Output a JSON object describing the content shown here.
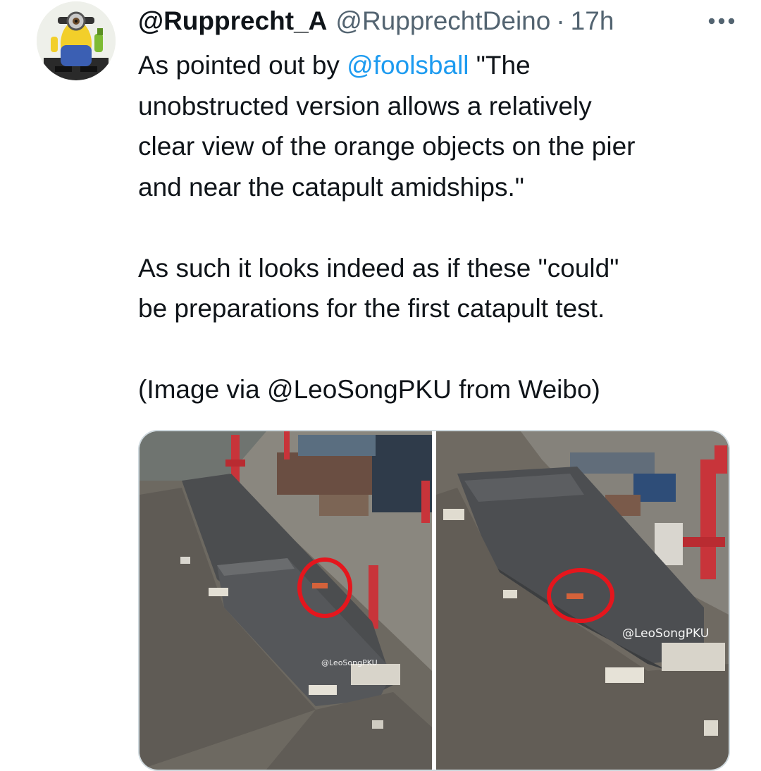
{
  "tweet": {
    "display_name": "@Rupprecht_A",
    "handle": "@RupprechtDeino",
    "separator": "·",
    "timestamp": "17h",
    "body": {
      "p1_prefix": "As pointed out by ",
      "p1_mention": "@foolsball",
      "p1_line1_suffix": " \"The",
      "p1_line2": "unobstructed version allows a relatively",
      "p1_line3": "clear view of the orange objects on the pier",
      "p1_line4": "and near the catapult amidships.\"",
      "p2_line1": "As such it looks indeed as if these \"could\"",
      "p2_line2": "be preparations for the first catapult test.",
      "p3": "(Image via @LeoSongPKU from Weibo)"
    }
  },
  "media": {
    "photo_left": {
      "watermark": "@LeoSongPKU"
    },
    "photo_right": {
      "watermark": "@LeoSongPKU"
    }
  },
  "icons": {
    "more": "more-horizontal-icon",
    "avatar": "minion-figure-avatar"
  },
  "colors": {
    "text_primary": "#0f1419",
    "text_secondary": "#536471",
    "link": "#1d9bf0",
    "highlight_circle": "#e5161d"
  }
}
